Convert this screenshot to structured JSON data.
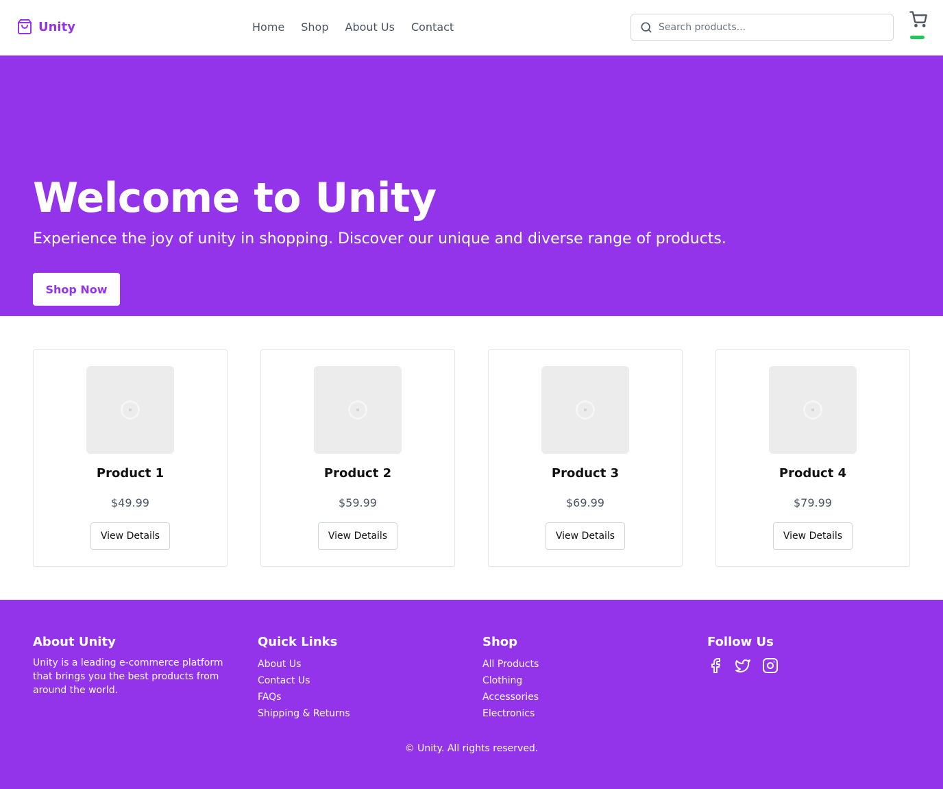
{
  "header": {
    "brand": "Unity",
    "nav": [
      "Home",
      "Shop",
      "About Us",
      "Contact"
    ],
    "search_placeholder": "Search products...",
    "cart_icon": "cart-icon"
  },
  "hero": {
    "title": "Welcome to Unity",
    "subtitle": "Experience the joy of unity in shopping. Discover our unique and diverse range of products.",
    "cta": "Shop Now"
  },
  "products": [
    {
      "name": "Product 1",
      "price": "$49.99",
      "button": "View Details"
    },
    {
      "name": "Product 2",
      "price": "$59.99",
      "button": "View Details"
    },
    {
      "name": "Product 3",
      "price": "$69.99",
      "button": "View Details"
    },
    {
      "name": "Product 4",
      "price": "$79.99",
      "button": "View Details"
    }
  ],
  "footer": {
    "about": {
      "title": "About Unity",
      "text": "Unity is a leading e-commerce platform that brings you the best products from around the world."
    },
    "quick_links": {
      "title": "Quick Links",
      "items": [
        "About Us",
        "Contact Us",
        "FAQs",
        "Shipping & Returns"
      ]
    },
    "shop": {
      "title": "Shop",
      "items": [
        "All Products",
        "Clothing",
        "Accessories",
        "Electronics"
      ]
    },
    "follow": {
      "title": "Follow Us",
      "icons": [
        "facebook-icon",
        "twitter-icon",
        "instagram-icon"
      ]
    },
    "copyright": "© Unity. All rights reserved."
  },
  "colors": {
    "brand": "#9333ea",
    "cart_indicator": "#22c55e"
  }
}
